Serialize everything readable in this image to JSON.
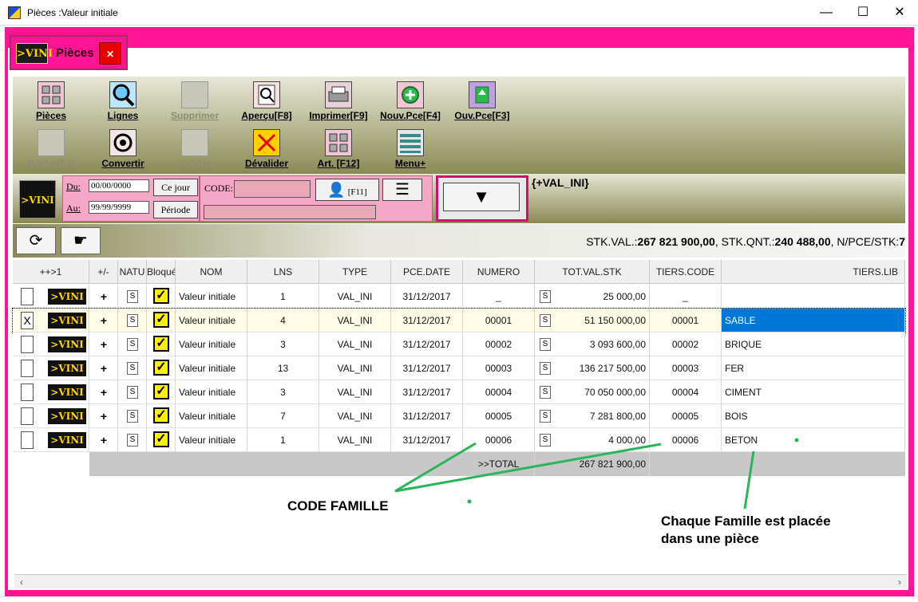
{
  "window": {
    "title": "Pièces :Valeur initiale",
    "minimize": "—",
    "maximize": "☐",
    "close": "✕"
  },
  "tab": {
    "logo": ">VINI",
    "label": "Pièces",
    "close": "✕"
  },
  "toolbar": {
    "row1": [
      "Pièces",
      "Lignes",
      "Supprimer",
      "Aperçu[F8]",
      "Imprimer[F9]",
      "Nouv.Pce[F4]",
      "Ouv.Pce[F3]"
    ],
    "row2": [
      "Régler[F2]",
      "Convertir",
      "Valider",
      "Dévalider",
      "Art. [F12]",
      "Menu+"
    ]
  },
  "filter": {
    "du_label": "Du:",
    "au_label": "Au:",
    "du_value": "00/00/0000",
    "au_value": "99/99/9999",
    "ce_jour": "Ce jour",
    "periode": "Période",
    "code_label": "CODE:",
    "f11": "[F11]",
    "val_ini": "{+VAL_INI}"
  },
  "stats": {
    "stk_val_label": "STK.VAL.:",
    "stk_val": "267 821 900,00",
    "stk_qnt_label": "STK.QNT.:",
    "stk_qnt": "240 488,00",
    "npce_label": "N/PCE/STK:",
    "npce": "7"
  },
  "grid": {
    "headers": [
      "++>1",
      "+/-",
      "NATU",
      "Bloqué",
      "NOM",
      "LNS",
      "TYPE",
      "PCE.DATE",
      "NUMERO",
      "TOT.VAL.STK",
      "TIERS.CODE",
      "TIERS.LIB"
    ],
    "rows": [
      {
        "checked": "",
        "nom": "Valeur initiale",
        "lns": "1",
        "type": "VAL_INI",
        "date": "31/12/2017",
        "numero": "_",
        "tot": "25 000,00",
        "tcode": "_",
        "tlib": ""
      },
      {
        "checked": "X",
        "nom": "Valeur initiale",
        "lns": "4",
        "type": "VAL_INI",
        "date": "31/12/2017",
        "numero": "00001",
        "tot": "51 150 000,00",
        "tcode": "00001",
        "tlib": "SABLE"
      },
      {
        "checked": "",
        "nom": "Valeur initiale",
        "lns": "3",
        "type": "VAL_INI",
        "date": "31/12/2017",
        "numero": "00002",
        "tot": "3 093 600,00",
        "tcode": "00002",
        "tlib": "BRIQUE"
      },
      {
        "checked": "",
        "nom": "Valeur initiale",
        "lns": "13",
        "type": "VAL_INI",
        "date": "31/12/2017",
        "numero": "00003",
        "tot": "136 217 500,00",
        "tcode": "00003",
        "tlib": "FER"
      },
      {
        "checked": "",
        "nom": "Valeur initiale",
        "lns": "3",
        "type": "VAL_INI",
        "date": "31/12/2017",
        "numero": "00004",
        "tot": "70 050 000,00",
        "tcode": "00004",
        "tlib": "CIMENT"
      },
      {
        "checked": "",
        "nom": "Valeur initiale",
        "lns": "7",
        "type": "VAL_INI",
        "date": "31/12/2017",
        "numero": "00005",
        "tot": "7 281 800,00",
        "tcode": "00005",
        "tlib": "BOIS"
      },
      {
        "checked": "",
        "nom": "Valeur initiale",
        "lns": "1",
        "type": "VAL_INI",
        "date": "31/12/2017",
        "numero": "00006",
        "tot": "4 000,00",
        "tcode": "00006",
        "tlib": "BETON"
      }
    ],
    "s_label": "S",
    "check_mark": "✓",
    "total_label": ">>TOTAL",
    "total_value": "267 821 900,00",
    "row_logo": ">VINI"
  },
  "annotations": {
    "code_famille": "CODE FAMILLE",
    "chaque": "Chaque Famille est placée",
    "dans": "dans une pièce"
  },
  "colors": {
    "frame": "#ff1493",
    "selected": "#0078d7",
    "toolbar_dark": "#8a8a55"
  }
}
